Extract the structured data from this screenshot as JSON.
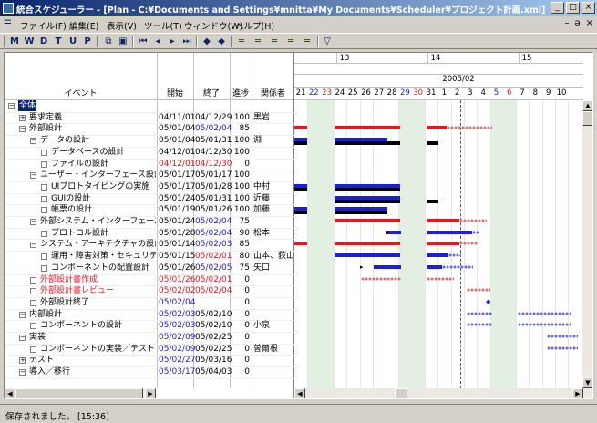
{
  "window": {
    "title": "統合スケジューラー - [Plan - C:¥Documents and Settings¥mnitta¥My Documents¥Scheduler¥プロジェクト計画.xml]",
    "min": "_",
    "max": "□",
    "close": "×"
  },
  "menu": [
    "ファイル(F)",
    "編集(E)",
    "表示(V)",
    "ツール(T)",
    "ウィンドウ(W)",
    "ヘルプ(H)"
  ],
  "mdi_controls": [
    "–",
    "ə",
    "×"
  ],
  "toolbar": {
    "letters": [
      "M",
      "W",
      "D",
      "T",
      "U",
      "P"
    ],
    "icons": [
      "copy-icon",
      "save-icon",
      "first-icon",
      "prev-icon",
      "next-icon",
      "last-icon",
      "up-icon",
      "down-icon",
      "align1-icon",
      "align2-icon",
      "align3-icon",
      "align4-icon",
      "align5-icon",
      "filter-icon"
    ]
  },
  "columns": {
    "event": "イベント",
    "start": "開始",
    "end": "終了",
    "progress": "進捗",
    "people": "関係者"
  },
  "gantt_header": {
    "week_labels": [
      "13",
      "14",
      "15"
    ],
    "month": "2005/02",
    "days": [
      "21",
      "22",
      "23",
      "24",
      "25",
      "26",
      "27",
      "28",
      "29",
      "30",
      "31",
      "1",
      "2",
      "3",
      "4",
      "5",
      "6",
      "7",
      "8",
      "9",
      "10"
    ]
  },
  "rows": [
    {
      "indent": 0,
      "box": "minus",
      "name": "全体",
      "start": "",
      "end": "",
      "progress": "",
      "people": "",
      "selected": true
    },
    {
      "indent": 1,
      "box": "plus",
      "name": "要求定義",
      "start": "04/11/01",
      "end": "04/12/29",
      "progress": "100",
      "people": "黒岩"
    },
    {
      "indent": 1,
      "box": "minus",
      "name": "外部設計",
      "start": "05/01/04",
      "end": "05/02/04",
      "progress": "85",
      "people": "",
      "end_color": "#1e1ed2"
    },
    {
      "indent": 2,
      "box": "minus",
      "name": "データの設計",
      "start": "05/01/04",
      "end": "05/01/31",
      "progress": "100",
      "people": "淵"
    },
    {
      "indent": 3,
      "box": "leaf",
      "name": "データベースの設計",
      "start": "04/12/01",
      "end": "04/12/30",
      "progress": "100",
      "people": ""
    },
    {
      "indent": 3,
      "box": "leaf",
      "name": "ファイルの設計",
      "start": "04/12/01",
      "end": "04/12/30",
      "progress": "0",
      "people": "",
      "start_color": "#e0191e",
      "end_color": "#e0191e"
    },
    {
      "indent": 2,
      "box": "minus",
      "name": "ユーザー・インターフェース設計",
      "start": "05/01/17",
      "end": "05/01/17",
      "progress": "100",
      "people": ""
    },
    {
      "indent": 3,
      "box": "leaf",
      "name": "UIプロトタイピングの実施",
      "start": "05/01/17",
      "end": "05/01/28",
      "progress": "100",
      "people": "中村"
    },
    {
      "indent": 3,
      "box": "leaf",
      "name": "GUIの設計",
      "start": "05/01/24",
      "end": "05/01/31",
      "progress": "100",
      "people": "近藤"
    },
    {
      "indent": 3,
      "box": "leaf",
      "name": "帳票の設計",
      "start": "05/01/19",
      "end": "05/01/26",
      "progress": "100",
      "people": "加藤"
    },
    {
      "indent": 2,
      "box": "minus",
      "name": "外部システム・インターフェース設計",
      "start": "05/01/24",
      "end": "05/02/04",
      "progress": "75",
      "people": "",
      "end_color": "#1e1ed2"
    },
    {
      "indent": 3,
      "box": "leaf",
      "name": "プロトコル設計",
      "start": "05/01/28",
      "end": "05/02/04",
      "progress": "90",
      "people": "松本",
      "end_color": "#1e1ed2"
    },
    {
      "indent": 2,
      "box": "minus",
      "name": "システム・アーキテクチャの設計",
      "start": "05/01/14",
      "end": "05/02/03",
      "progress": "85",
      "people": "",
      "end_color": "#1e1ed2"
    },
    {
      "indent": 3,
      "box": "leaf",
      "name": "運用・障害対策・セキュリティの設",
      "start": "05/01/15",
      "end": "05/02/01",
      "progress": "80",
      "people": "山本、荻山",
      "end_color": "#e0191e"
    },
    {
      "indent": 3,
      "box": "leaf",
      "name": "コンポーネントの配置設計",
      "start": "05/01/26",
      "end": "05/02/05",
      "progress": "75",
      "people": "矢口",
      "end_color": "#1e1ed2"
    },
    {
      "indent": 2,
      "box": "leaf",
      "name": "外部設計書作成",
      "start": "05/01/26",
      "end": "05/02/01",
      "progress": "0",
      "people": "",
      "name_color": "#e0191e",
      "start_color": "#e0191e",
      "end_color": "#e0191e"
    },
    {
      "indent": 2,
      "box": "leaf",
      "name": "外部設計書レビュー",
      "start": "05/02/02",
      "end": "05/02/04",
      "progress": "0",
      "people": "",
      "name_color": "#e0191e",
      "start_color": "#e0191e",
      "end_color": "#e0191e"
    },
    {
      "indent": 2,
      "box": "leaf",
      "name": "外部設計終了",
      "start": "05/02/04",
      "end": "",
      "progress": "0",
      "people": "",
      "start_color": "#1e1ed2"
    },
    {
      "indent": 1,
      "box": "minus",
      "name": "内部設計",
      "start": "05/02/03",
      "end": "05/02/10",
      "progress": "0",
      "people": "",
      "start_color": "#1e1ed2"
    },
    {
      "indent": 2,
      "box": "leaf",
      "name": "コンポーネントの設計",
      "start": "05/02/03",
      "end": "05/02/10",
      "progress": "0",
      "people": "小泉",
      "start_color": "#1e1ed2"
    },
    {
      "indent": 1,
      "box": "minus",
      "name": "実装",
      "start": "05/02/09",
      "end": "05/02/25",
      "progress": "0",
      "people": "",
      "start_color": "#1e1ed2"
    },
    {
      "indent": 2,
      "box": "leaf",
      "name": "コンポーネントの実装／テスト",
      "start": "05/02/09",
      "end": "05/02/25",
      "progress": "0",
      "people": "曽爾根",
      "start_color": "#1e1ed2"
    },
    {
      "indent": 1,
      "box": "plus",
      "name": "テスト",
      "start": "05/02/27",
      "end": "05/03/16",
      "progress": "0",
      "people": "",
      "start_color": "#1e1ed2"
    },
    {
      "indent": 1,
      "box": "minus",
      "name": "導入／移行",
      "start": "05/03/17",
      "end": "05/04/03",
      "progress": "0",
      "people": "",
      "start_color": "#1e1ed2"
    }
  ],
  "status": "保存されました。 [15:36]"
}
